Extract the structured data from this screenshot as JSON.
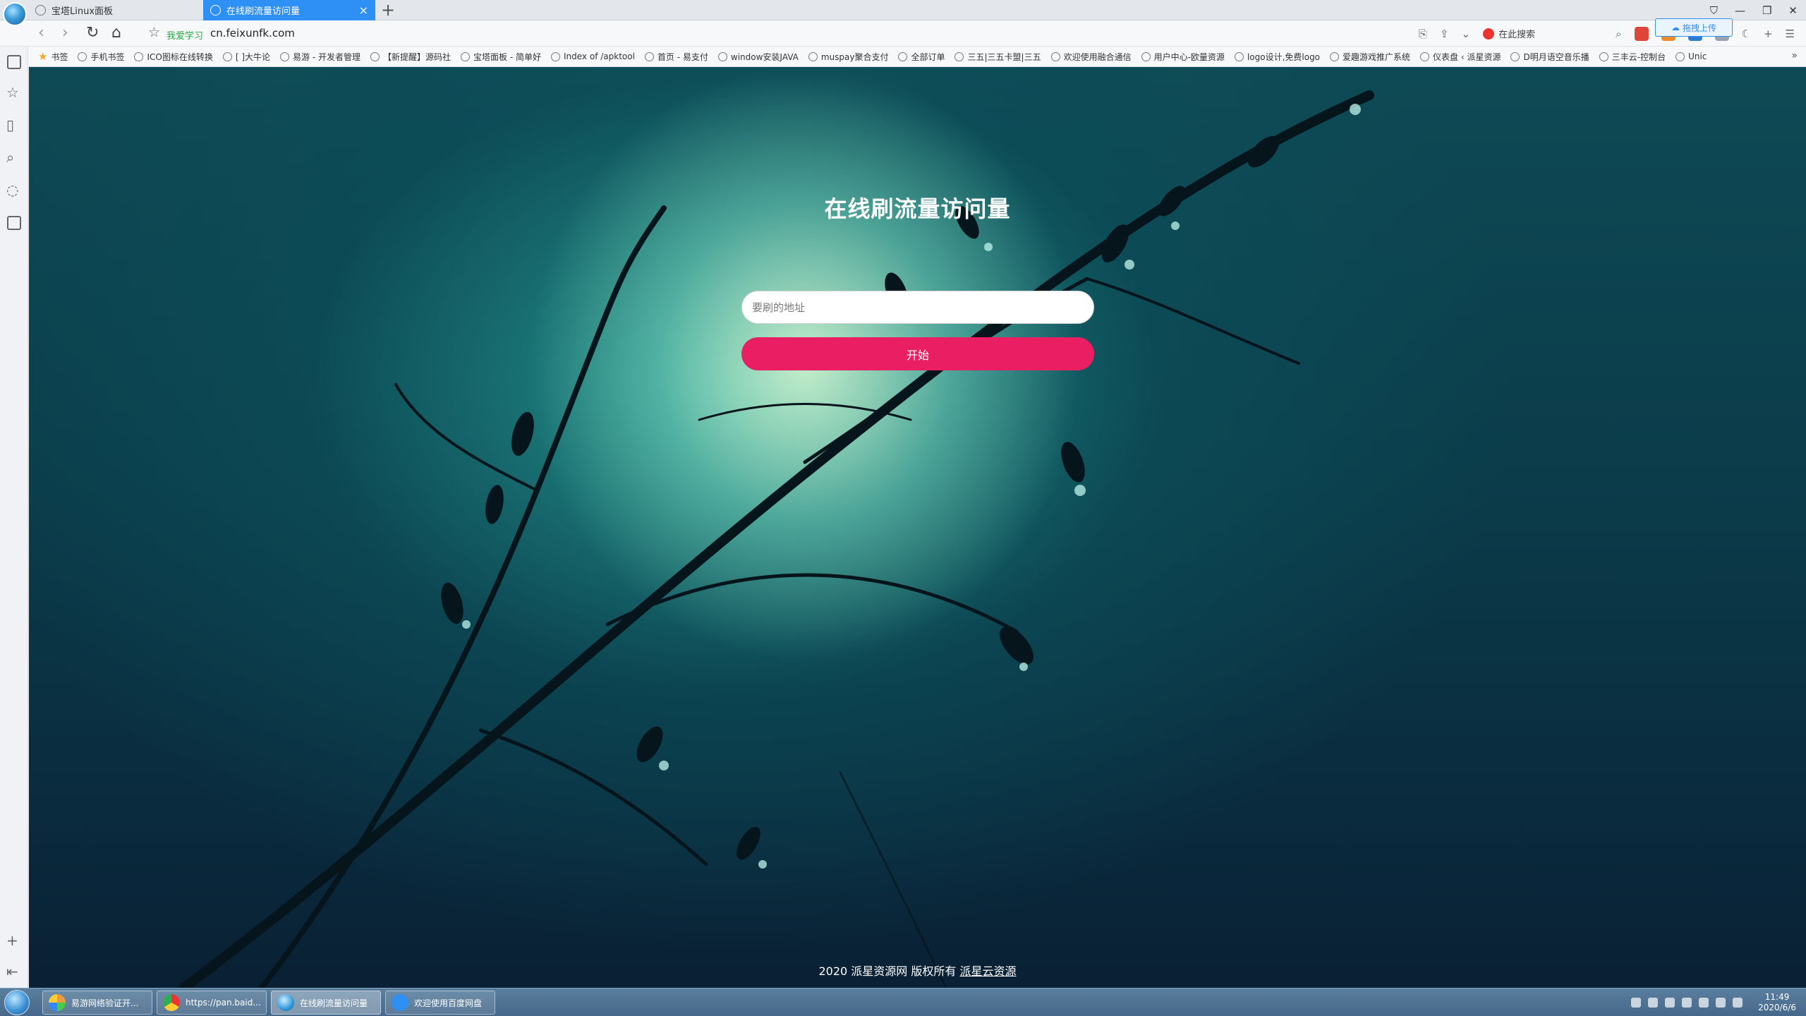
{
  "tabs": [
    {
      "label": "宝塔Linux面板",
      "active": false
    },
    {
      "label": "在线刷流量访问量",
      "active": true
    }
  ],
  "tab_close_glyph": "×",
  "tab_new_glyph": "+",
  "window_controls": [
    "⛉",
    "—",
    "❐",
    "✕"
  ],
  "addressbar": {
    "site_tag": "我爱学习",
    "url": "cn.feixunfk.com",
    "search_placeholder": "在此搜索",
    "upload_label": "拖拽上传"
  },
  "bookmarks": [
    "书签",
    "手机书签",
    "ICO图标在线转换",
    "[ ]大牛论",
    "易游 - 开发者管理",
    "【新提醒】源码社",
    "宝塔面板 - 简单好",
    "Index of /apktool",
    "首页 - 易支付",
    "window安装JAVA",
    "muspay聚合支付",
    "全部订单",
    "三五|三五卡盟|三五",
    "欢迎使用融合通信",
    "用户中心-欧量资源",
    "logo设计,免费logo",
    "爱趣游戏推广系统",
    "仪表盘 ‹ 派星资源",
    "D明月语空音乐播",
    "三丰云-控制台",
    "Unic"
  ],
  "page": {
    "title": "在线刷流量访问量",
    "input_placeholder": "要刷的地址",
    "input_value": "",
    "start_button": "开始",
    "footer_text": "2020 派星资源网 版权所有",
    "footer_link": "派星云资源"
  },
  "taskbar": {
    "items": [
      {
        "label": "易游网络验证开...",
        "active": false
      },
      {
        "label": "https://pan.baid...",
        "active": false
      },
      {
        "label": "在线刷流量访问量",
        "active": true
      },
      {
        "label": "欢迎使用百度网盘",
        "active": false
      }
    ],
    "time": "11:49",
    "date": "2020/6/6"
  },
  "colors": {
    "accent": "#e91e63",
    "active_tab": "#2e8ff5",
    "bg_teal": "#0e4a55"
  }
}
